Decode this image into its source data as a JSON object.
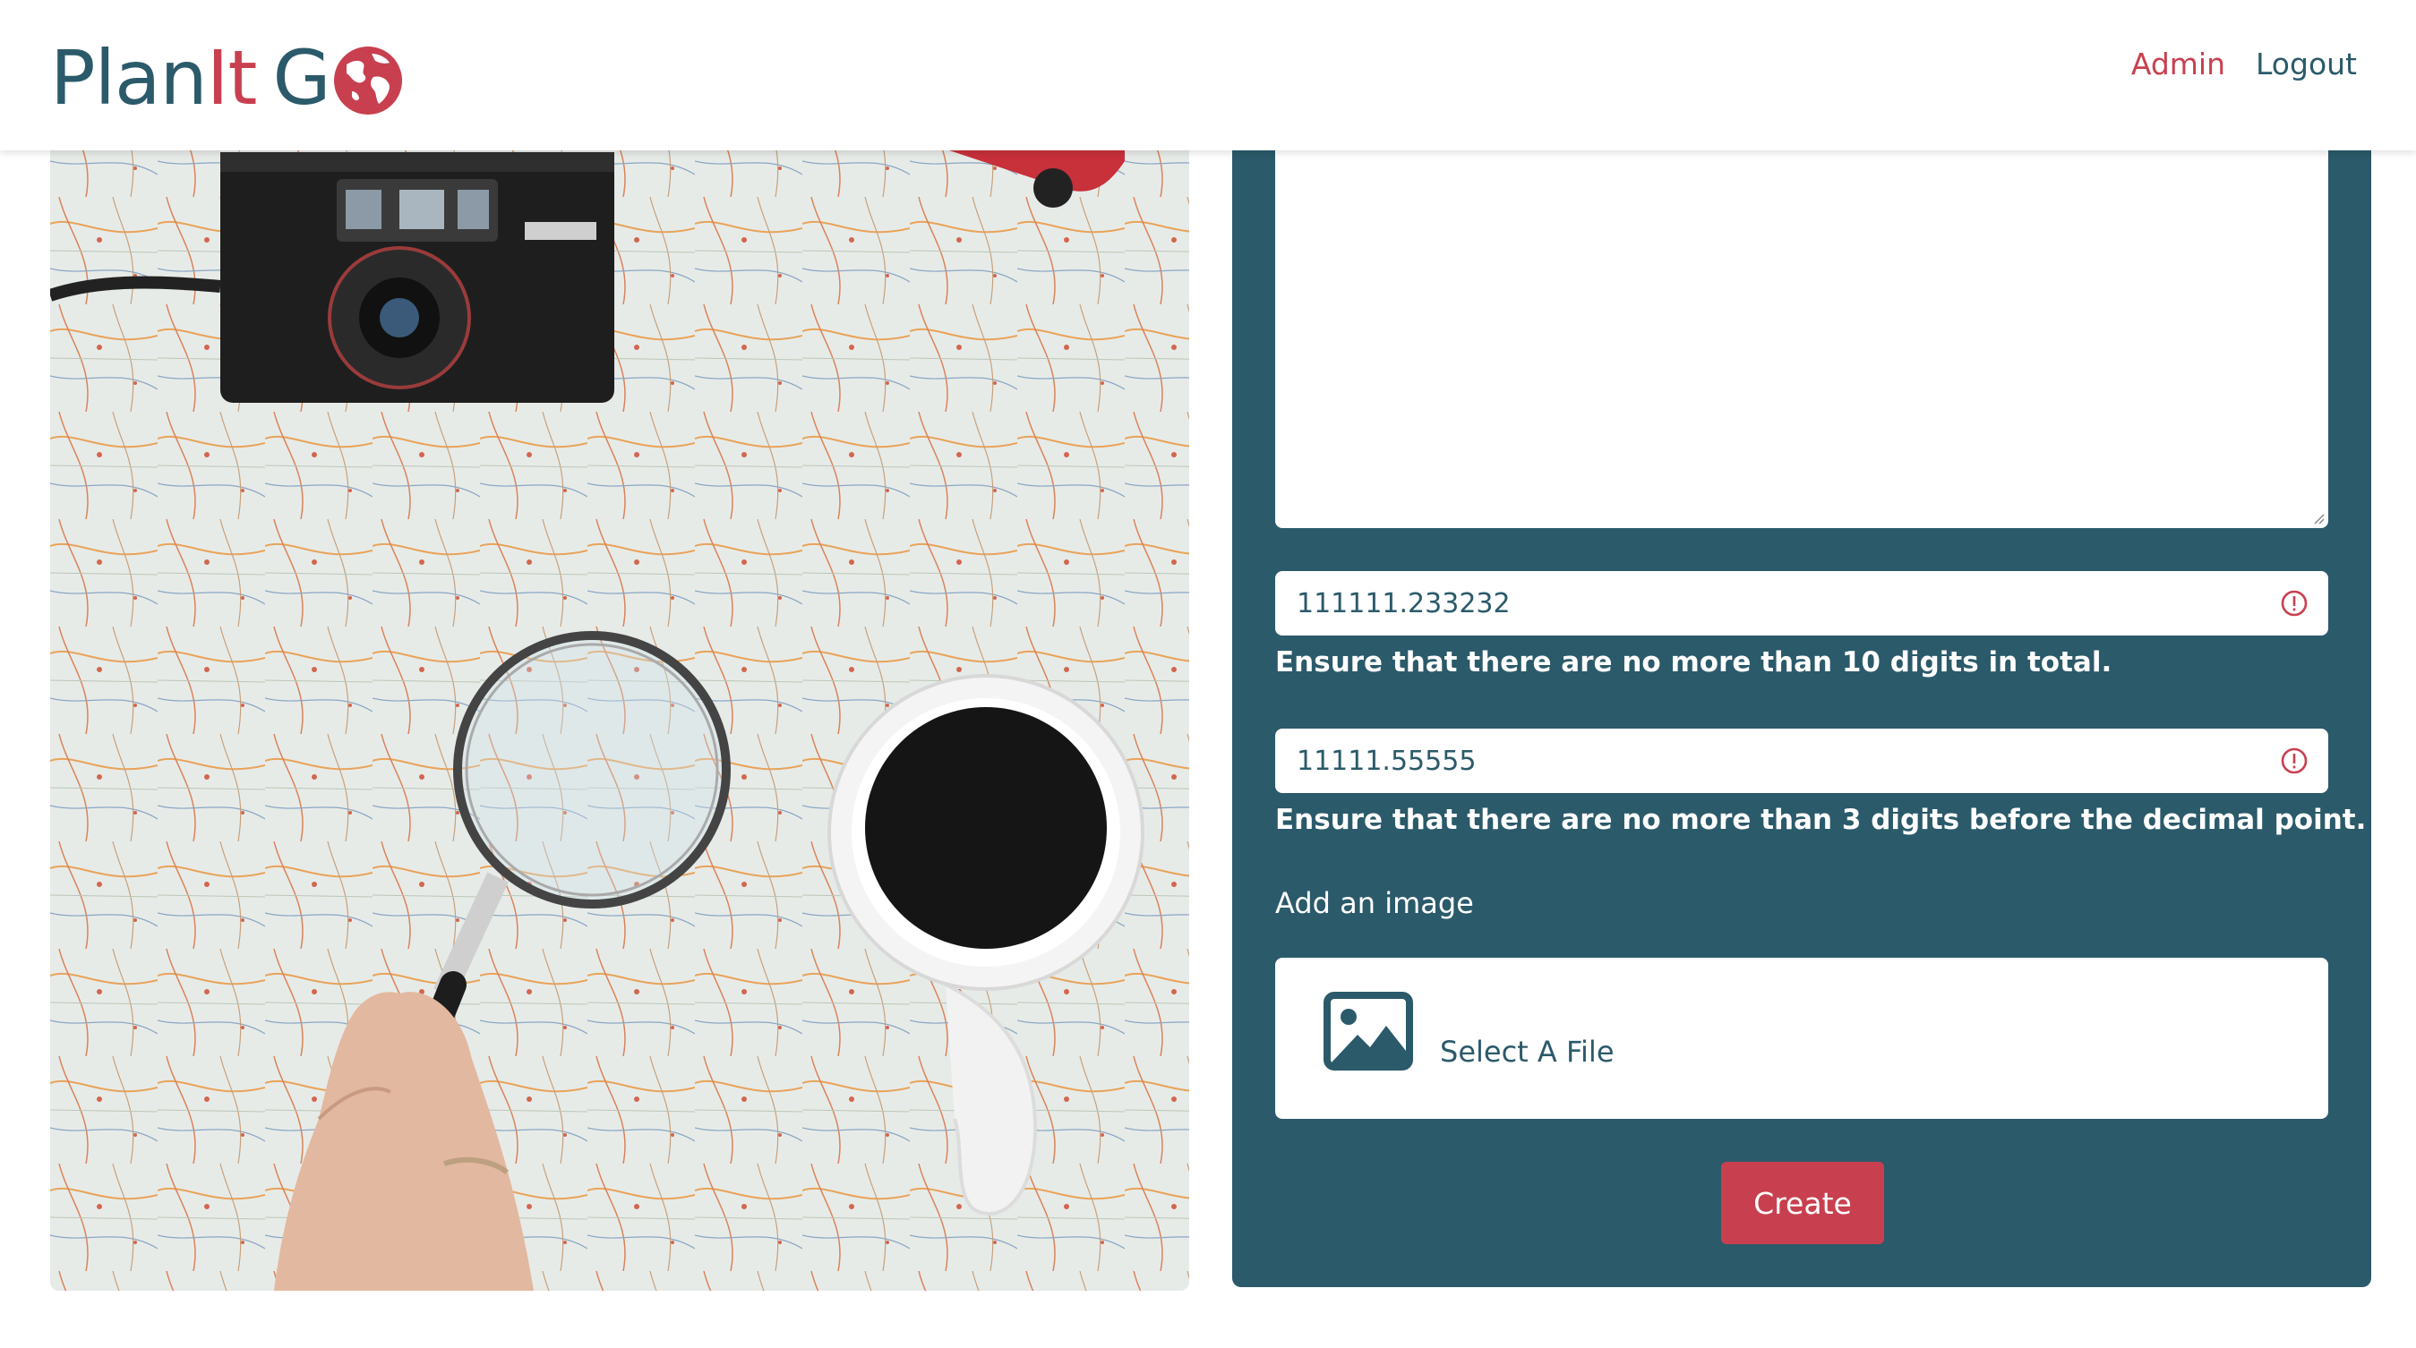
{
  "brand": {
    "part1": "Plan",
    "part2": "It",
    "part3": "G",
    "logo_icon": "globe-icon"
  },
  "nav": {
    "admin": "Admin",
    "logout": "Logout"
  },
  "hero_image": {
    "icons": [
      "camera",
      "magnifying-glass",
      "coffee-cup",
      "toy-van",
      "map"
    ]
  },
  "form": {
    "description_value": "",
    "field1": {
      "value": "111111.233232",
      "error": "Ensure that there are no more than 10 digits in total.",
      "status_icon": "alert-circle-icon"
    },
    "field2": {
      "value": "11111.55555",
      "error": "Ensure that there are no more than 3 digits before the decimal point.",
      "status_icon": "alert-circle-icon"
    },
    "image_label": "Add an image",
    "file_select_label": "Select A File",
    "submit_label": "Create"
  },
  "colors": {
    "primary": "#2b5a6a",
    "accent": "#c8404f",
    "white": "#ffffff"
  }
}
